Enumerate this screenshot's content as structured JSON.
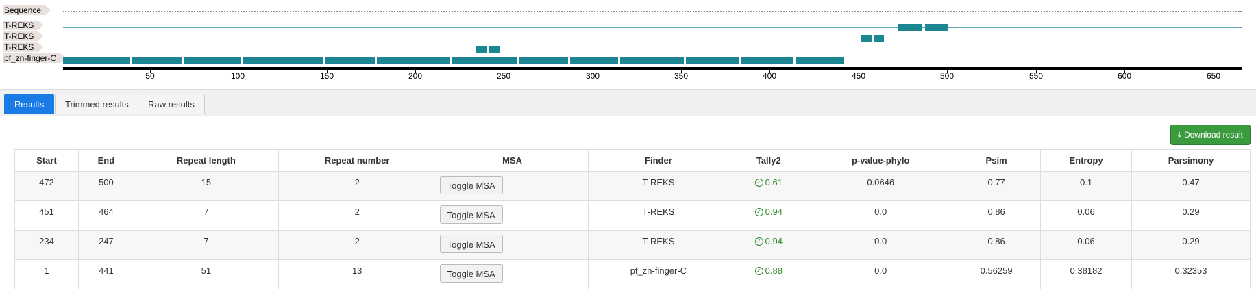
{
  "viewer": {
    "tracks": [
      "Sequence",
      "T-REKS",
      "T-REKS",
      "T-REKS",
      "pf_zn-finger-C"
    ],
    "axis_ticks": [
      "50",
      "100",
      "150",
      "200",
      "250",
      "300",
      "350",
      "400",
      "450",
      "500",
      "550",
      "600",
      "650"
    ]
  },
  "tabs": [
    "Results",
    "Trimmed results",
    "Raw results"
  ],
  "download_label": "Download result",
  "table": {
    "headers": [
      "Start",
      "End",
      "Repeat length",
      "Repeat number",
      "MSA",
      "Finder",
      "Tally2",
      "p-value-phylo",
      "Psim",
      "Entropy",
      "Parsimony"
    ],
    "rows": [
      {
        "start": "472",
        "end": "500",
        "length": "15",
        "number": "2",
        "msa": "Toggle MSA",
        "finder": "T-REKS",
        "tally": "0.61",
        "pvalue": "0.0646",
        "psim": "0.77",
        "entropy": "0.1",
        "parsimony": "0.47"
      },
      {
        "start": "451",
        "end": "464",
        "length": "7",
        "number": "2",
        "msa": "Toggle MSA",
        "finder": "T-REKS",
        "tally": "0.94",
        "pvalue": "0.0",
        "psim": "0.86",
        "entropy": "0.06",
        "parsimony": "0.29"
      },
      {
        "start": "234",
        "end": "247",
        "length": "7",
        "number": "2",
        "msa": "Toggle MSA",
        "finder": "T-REKS",
        "tally": "0.94",
        "pvalue": "0.0",
        "psim": "0.86",
        "entropy": "0.06",
        "parsimony": "0.29"
      },
      {
        "start": "1",
        "end": "441",
        "length": "51",
        "number": "13",
        "msa": "Toggle MSA",
        "finder": "pf_zn-finger-C",
        "tally": "0.88",
        "pvalue": "0.0",
        "psim": "0.56259",
        "entropy": "0.38182",
        "parsimony": "0.32353"
      }
    ]
  }
}
